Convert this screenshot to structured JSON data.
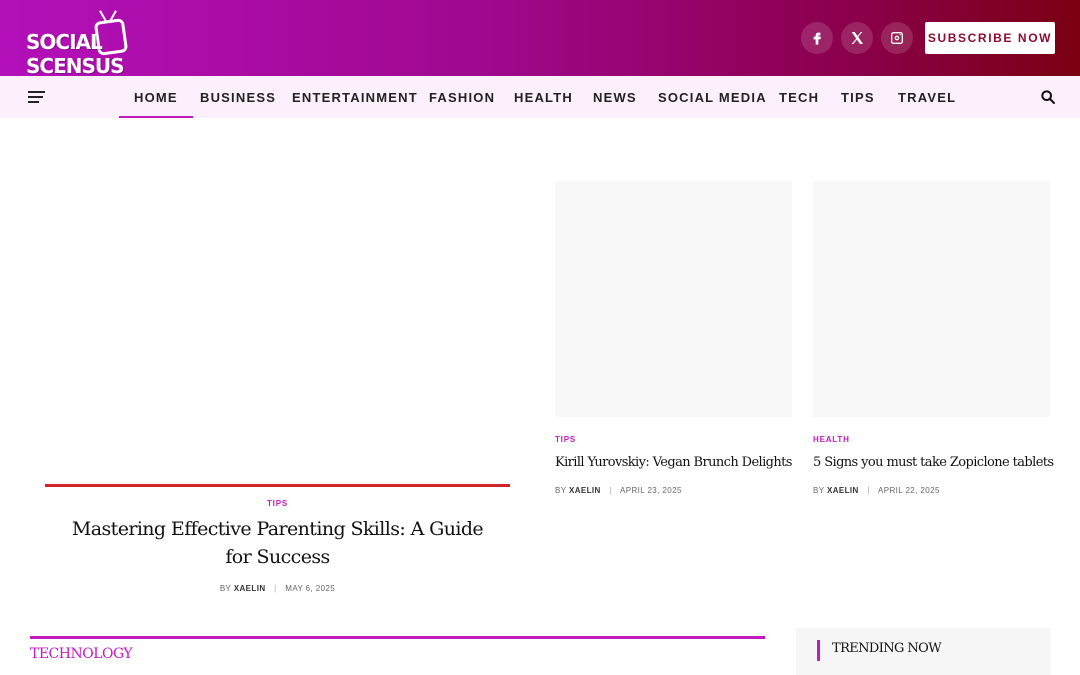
{
  "brand": {
    "logo_text": "SOCIAL SCENSUS",
    "gradient_start": "#b310b9",
    "gradient_end": "#7a0012",
    "accent": "#c21bbd"
  },
  "header": {
    "social_icons": [
      "facebook-icon",
      "x-icon",
      "instagram-icon"
    ],
    "subscribe_label": "SUBSCRIBE NOW"
  },
  "nav": {
    "items": [
      "HOME",
      "BUSINESS",
      "ENTERTAINMENT",
      "FASHION",
      "HEALTH",
      "NEWS",
      "SOCIAL MEDIA",
      "TECH",
      "TIPS",
      "TRAVEL"
    ],
    "active": "HOME"
  },
  "featured": {
    "category": "TIPS",
    "title": "Mastering Effective Parenting Skills: A Guide for Success",
    "by": "BY",
    "author": "XAELIN",
    "date": "MAY 6, 2025"
  },
  "cards": [
    {
      "category": "TIPS",
      "title": "Kirill Yurovskiy: Vegan Brunch Delights",
      "by": "BY",
      "author": "XAELIN",
      "date": "APRIL 23, 2025"
    },
    {
      "category": "HEALTH",
      "title": "5 Signs you must take Zopiclone tablets",
      "by": "BY",
      "author": "XAELIN",
      "date": "APRIL 22, 2025"
    }
  ],
  "sections": {
    "technology": "TECHNOLOGY",
    "trending": "TRENDING NOW"
  }
}
